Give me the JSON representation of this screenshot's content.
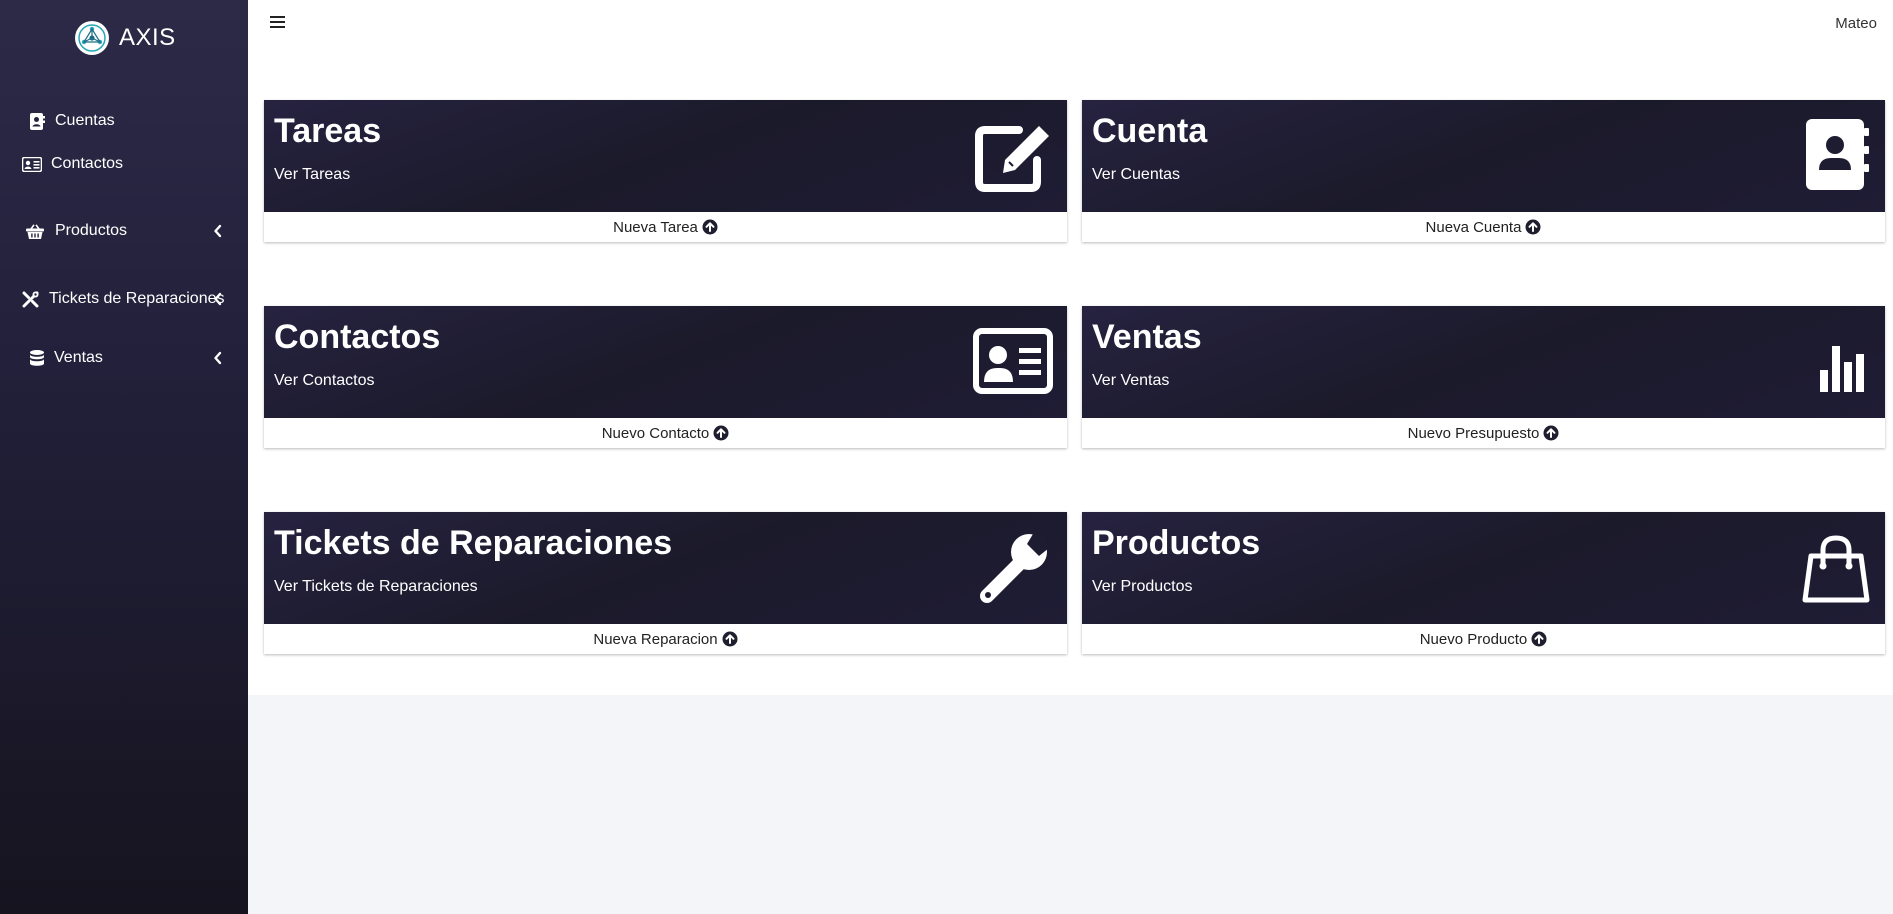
{
  "brand": {
    "name": "AXIS",
    "icon": "axis-logo"
  },
  "topbar": {
    "menu_icon": "hamburger-icon",
    "user": "Mateo"
  },
  "sidebar": {
    "items": [
      {
        "label": "Cuentas",
        "icon": "address-book-icon",
        "has_submenu": false
      },
      {
        "label": "Contactos",
        "icon": "id-card-icon",
        "has_submenu": false
      },
      {
        "label": "Productos",
        "icon": "basket-icon",
        "has_submenu": true
      },
      {
        "label": "Tickets de Reparaciones",
        "icon": "tools-icon",
        "has_submenu": true
      },
      {
        "label": "Ventas",
        "icon": "database-icon",
        "has_submenu": true
      }
    ]
  },
  "cards": [
    {
      "title": "Tareas",
      "subtitle": "Ver Tareas",
      "action": "Nueva Tarea",
      "icon": "edit-icon"
    },
    {
      "title": "Cuenta",
      "subtitle": "Ver Cuentas",
      "action": "Nueva Cuenta",
      "icon": "address-book-icon"
    },
    {
      "title": "Contactos",
      "subtitle": "Ver Contactos",
      "action": "Nuevo Contacto",
      "icon": "id-card-icon"
    },
    {
      "title": "Ventas",
      "subtitle": "Ver Ventas",
      "action": "Nuevo Presupuesto",
      "icon": "bar-chart-icon"
    },
    {
      "title": "Tickets de Reparaciones",
      "subtitle": "Ver Tickets de Reparaciones",
      "action": "Nueva Reparacion",
      "icon": "wrench-icon"
    },
    {
      "title": "Productos",
      "subtitle": "Ver Productos",
      "action": "Nuevo Producto",
      "icon": "shopping-bag-icon"
    }
  ],
  "colors": {
    "sidebar_top": "#2c2a47",
    "sidebar_bottom": "#16141f",
    "card_header": "#1f1c32",
    "page_bg": "#f4f5f9"
  }
}
